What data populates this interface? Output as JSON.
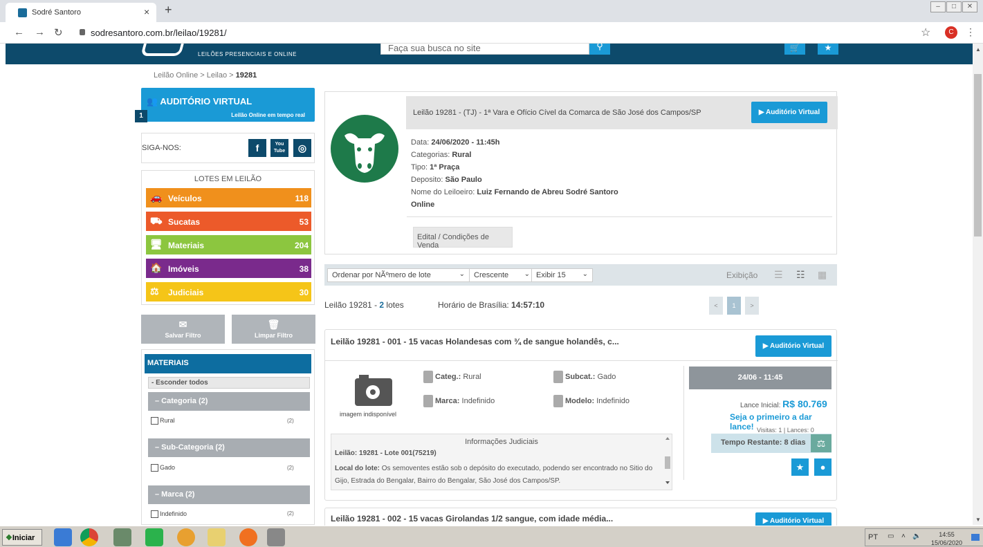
{
  "browser": {
    "tab_title": "Sodré Santoro",
    "tab_close": "×",
    "new_tab": "+",
    "url": "sodresantoro.com.br/leilao/19281/",
    "profile_initial": "C"
  },
  "header": {
    "logo_subtitle": "LEILÕES PRESENCIAIS E ONLINE",
    "search_placeholder": "Faça sua busca no site"
  },
  "breadcrumb": {
    "part1": "Leilão Online > ",
    "part2": "Leilao > ",
    "current": "19281"
  },
  "sidebar": {
    "auditorio_title": "AUDITÓRIO VIRTUAL",
    "auditorio_sub": "Leilão Online em tempo real",
    "auditorio_badge": "1",
    "siga_label": "SIGA-NOS:",
    "social": [
      "f",
      "You Tube",
      "ig"
    ],
    "lotes_header": "LOTES EM LEILÃO",
    "lotes": [
      {
        "label": "Veículos",
        "count": "118",
        "color": "#f0901c"
      },
      {
        "label": "Sucatas",
        "count": "53",
        "color": "#ec5a2a"
      },
      {
        "label": "Materiais",
        "count": "204",
        "color": "#8cc63f"
      },
      {
        "label": "Imóveis",
        "count": "38",
        "color": "#7a2a8c"
      },
      {
        "label": "Judiciais",
        "count": "30",
        "color": "#f5c518"
      }
    ],
    "salvar_filtro": "Salvar Filtro",
    "limpar_filtro": "Limpar Filtro",
    "filter_header": "MATERIAIS",
    "esconder": "- Esconder todos",
    "groups": [
      {
        "label": "–  Categoria (2)",
        "option": "Rural",
        "count": "(2)"
      },
      {
        "label": "–  Sub-Categoria (2)",
        "option": "Gado",
        "count": "(2)"
      },
      {
        "label": "–  Marca (2)",
        "option": "Indefinido",
        "count": "(2)"
      }
    ]
  },
  "auction": {
    "title": "Leilão 19281 - (TJ) - 1ª Vara e Ofício Cível da Comarca de São José dos Campos/SP",
    "auditorio_btn": "Auditório Virtual",
    "data_label": "Data: ",
    "data_value": "24/06/2020 - 11:45h",
    "categorias_label": "Categorias: ",
    "categorias_value": "Rural",
    "tipo_label": "Tipo: ",
    "tipo_value": "1ª Praça",
    "deposito_label": "Deposito: ",
    "deposito_value": "São Paulo",
    "leiloeiro_label": "Nome do Leiloeiro: ",
    "leiloeiro_value": "Luiz Fernando de Abreu Sodré Santoro",
    "modalidade": "Online",
    "edital": "Edital / Condições de Venda"
  },
  "sortbar": {
    "order": "Ordenar por NÃºmero de lote",
    "direction": "Crescente",
    "per_page": "Exibir 15",
    "exibicao": "Exibição"
  },
  "results": {
    "prefix": "Leilão 19281 - ",
    "count": "2",
    "suffix": " lotes",
    "clock_label": "Horário de Brasília: ",
    "clock_value": "14:57:10",
    "pages": [
      "<",
      "1",
      ">"
    ]
  },
  "lot1": {
    "title": "Leilão 19281 - 001 - 15 vacas Holandesas com ¾ de sangue holandês, c...",
    "auditorio_btn": "Auditório Virtual",
    "no_image": "imagem indisponível",
    "categ_label": "Categ.:",
    "categ_value": "Rural",
    "subcat_label": "Subcat.:",
    "subcat_value": "Gado",
    "marca_label": "Marca:",
    "marca_value": "Indefinido",
    "modelo_label": "Modelo:",
    "modelo_value": "Indefinido",
    "judicial_header": "Informações Judiciais",
    "judicial_line1": "Leilão: 19281 - Lote 001(75219)",
    "judicial_local_label": "Local do lote:",
    "judicial_local_text": " Os semoventes estão sob o depósito do executado, podendo ser encontrado no Sitio do Gijo, Estrada do Bengalar, Bairro do Bengalar, São José dos Campos/SP.",
    "date": "24/06 - 11:45",
    "lance_label": "Lance Inicial: ",
    "lance_value": "R$ 80.769",
    "first_bid": "Seja o primeiro a dar lance!",
    "visitas": "Visitas: 1 | Lances: 0",
    "tempo": "Tempo Restante: 8 dias"
  },
  "lot2": {
    "title": "Leilão 19281 - 002 - 15 vacas Girolandas 1/2 sangue, com idade média...",
    "auditorio_btn": "Auditório Virtual"
  },
  "taskbar": {
    "start": "Iniciar",
    "lang": "PT",
    "time": "14:55",
    "date": "15/06/2020"
  }
}
